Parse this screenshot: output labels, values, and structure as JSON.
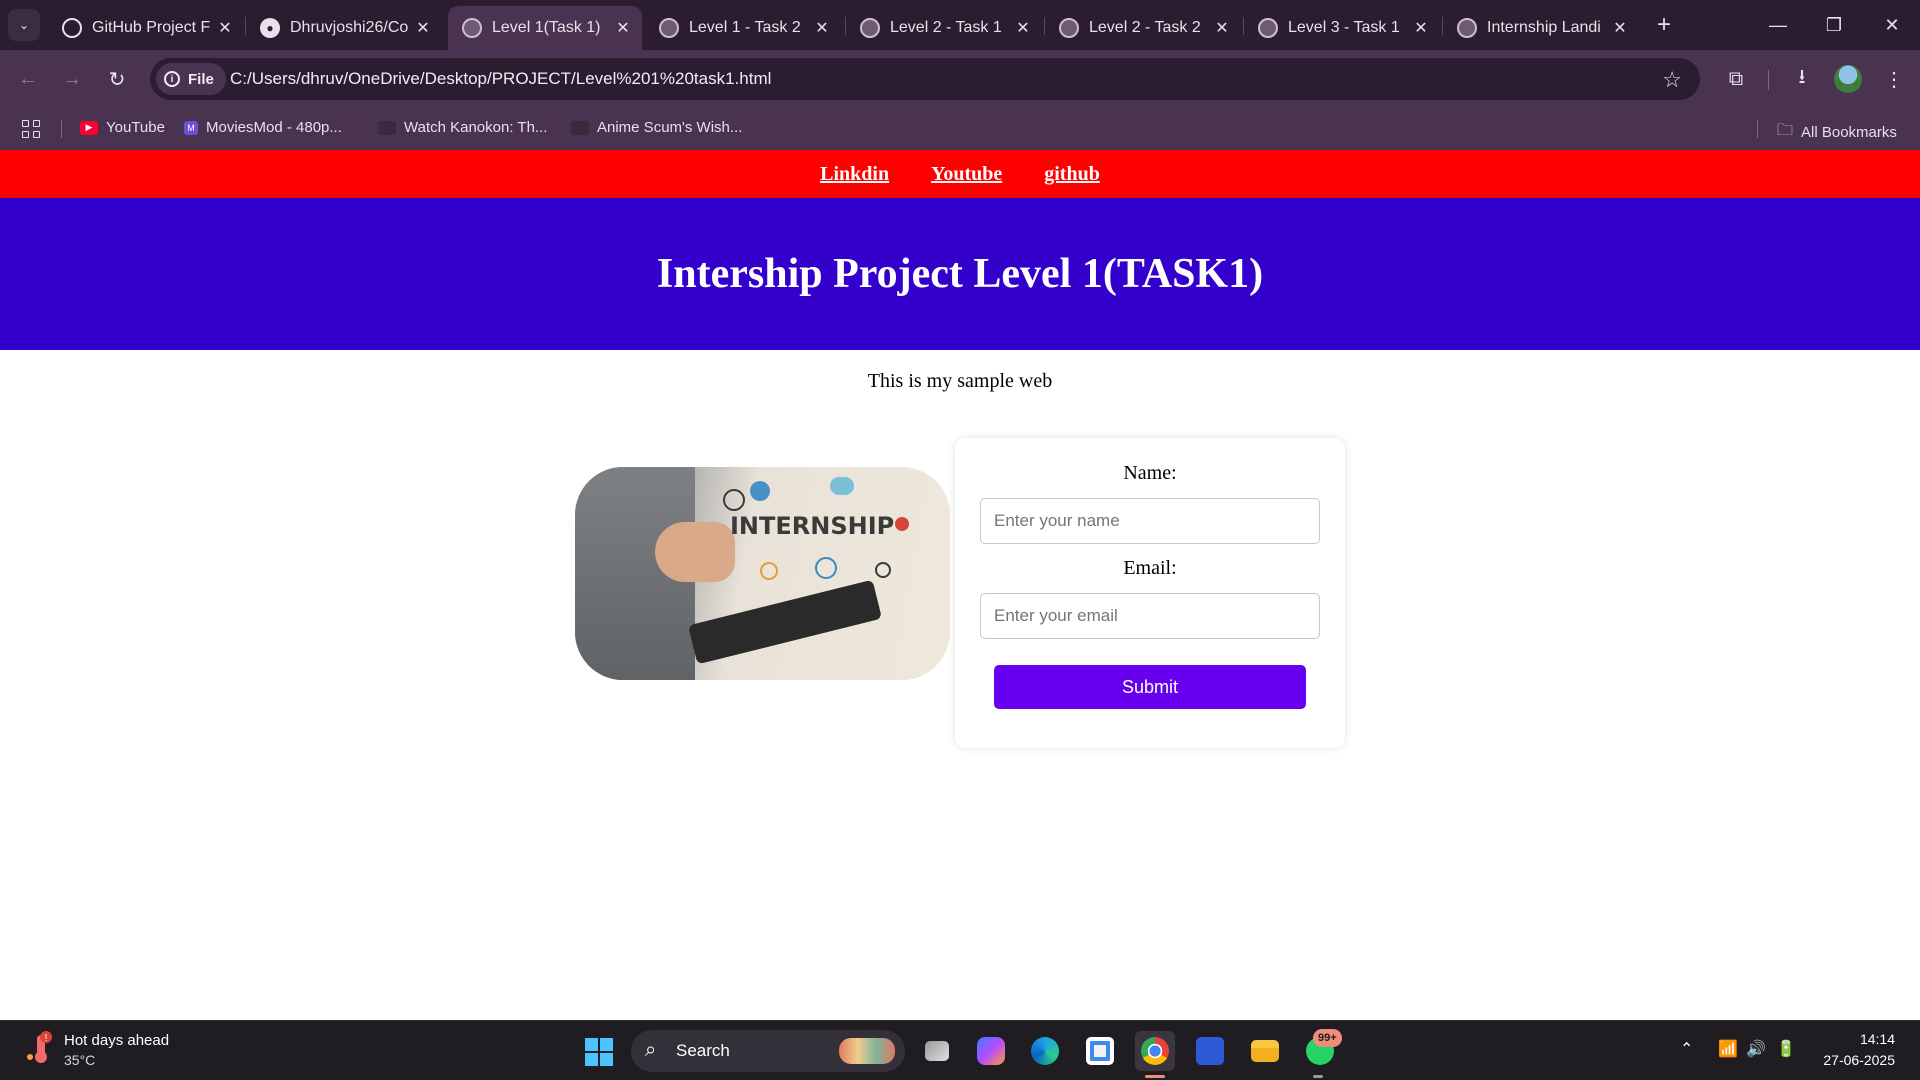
{
  "browser": {
    "tabs": [
      {
        "title": "GitHub Project F",
        "icon": "chatgpt-icon"
      },
      {
        "title": "Dhruvjoshi26/Co",
        "icon": "github-icon"
      },
      {
        "title": "Level 1(Task 1)",
        "icon": "globe-icon",
        "active": true
      },
      {
        "title": "Level 1 - Task 2",
        "icon": "globe-icon"
      },
      {
        "title": "Level 2 - Task 1",
        "icon": "globe-icon"
      },
      {
        "title": "Level 2 - Task 2",
        "icon": "globe-icon"
      },
      {
        "title": "Level 3 - Task 1",
        "icon": "globe-icon"
      },
      {
        "title": "Internship Landi",
        "icon": "globe-icon"
      }
    ],
    "omnibox": {
      "chip_label": "File",
      "url": "C:/Users/dhruv/OneDrive/Desktop/PROJECT/Level%201%20task1.html"
    },
    "bookmarks": [
      {
        "label": "YouTube",
        "icon": "youtube-icon",
        "color": "#ff0033"
      },
      {
        "label": "MoviesMod - 480p...",
        "icon": "moviesmod-icon",
        "color": "#6b4fd8"
      },
      {
        "label": "Watch Kanokon: Th...",
        "icon": "play-icon",
        "color": "#3a2a3e"
      },
      {
        "label": "Anime Scum's Wish...",
        "icon": "play-icon",
        "color": "#3a2a3e"
      }
    ],
    "all_bookmarks_label": "All Bookmarks"
  },
  "page": {
    "nav_links": [
      "Linkdin",
      "Youtube",
      "github"
    ],
    "heading": "Intership Project Level 1(TASK1)",
    "intro": "This is my sample web",
    "image_caption": "INTERNSHIP",
    "form": {
      "name_label": "Name:",
      "name_placeholder": "Enter your name",
      "email_label": "Email:",
      "email_placeholder": "Enter your email",
      "submit_label": "Submit"
    }
  },
  "taskbar": {
    "weather_title": "Hot days ahead",
    "weather_temp": "35°C",
    "weather_badge": "!",
    "search_label": "Search",
    "whatsapp_badge": "99+",
    "time": "14:14",
    "date": "27-06-2025"
  },
  "colors": {
    "nav_bar": "#ff0000",
    "hero": "#3300cc",
    "submit": "#6600ee",
    "chrome_dark": "#2b1c2f",
    "chrome_light": "#4a3350"
  }
}
